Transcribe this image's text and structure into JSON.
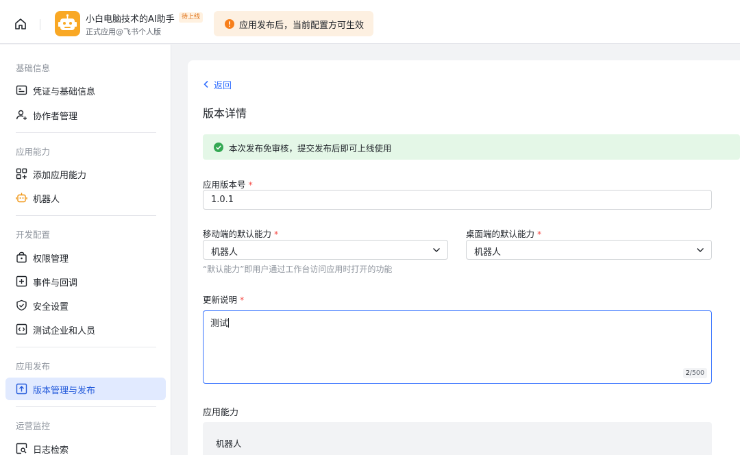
{
  "header": {
    "app_name": "小白电脑技术的AI助手",
    "status_badge": "待上线",
    "app_subtitle": "正式应用@飞书个人版",
    "notice_text": "应用发布后，当前配置方可生效",
    "brand_color": "#f9a825"
  },
  "sidebar": {
    "sections": [
      {
        "title": "基础信息",
        "items": [
          {
            "label": "凭证与基础信息",
            "icon": "credential-icon"
          },
          {
            "label": "协作者管理",
            "icon": "add-user-icon"
          }
        ]
      },
      {
        "title": "应用能力",
        "items": [
          {
            "label": "添加应用能力",
            "icon": "add-capability-icon"
          },
          {
            "label": "机器人",
            "icon": "robot-icon"
          }
        ]
      },
      {
        "title": "开发配置",
        "items": [
          {
            "label": "权限管理",
            "icon": "lock-icon"
          },
          {
            "label": "事件与回调",
            "icon": "event-icon"
          },
          {
            "label": "安全设置",
            "icon": "shield-icon"
          },
          {
            "label": "测试企业和人员",
            "icon": "code-icon"
          }
        ]
      },
      {
        "title": "应用发布",
        "items": [
          {
            "label": "版本管理与发布",
            "icon": "upload-icon",
            "active": true
          }
        ]
      },
      {
        "title": "运营监控",
        "items": [
          {
            "label": "日志检索",
            "icon": "log-search-icon"
          }
        ]
      }
    ]
  },
  "main": {
    "back_label": "返回",
    "title": "版本详情",
    "success_message": "本次发布免审核，提交发布后即可上线使用",
    "version": {
      "label": "应用版本号",
      "required_mark": "*",
      "value": "1.0.1"
    },
    "mobile_default": {
      "label": "移动端的默认能力",
      "required_mark": "*",
      "value": "机器人"
    },
    "desktop_default": {
      "label": "桌面端的默认能力",
      "required_mark": "*",
      "value": "机器人"
    },
    "default_hint": "“默认能力”即用户通过工作台访问应用时打开的功能",
    "update_notes": {
      "label": "更新说明",
      "required_mark": "*",
      "value": "测试",
      "count": "2",
      "max": "/500"
    },
    "capabilities": {
      "title": "应用能力",
      "items": [
        "机器人"
      ]
    }
  }
}
